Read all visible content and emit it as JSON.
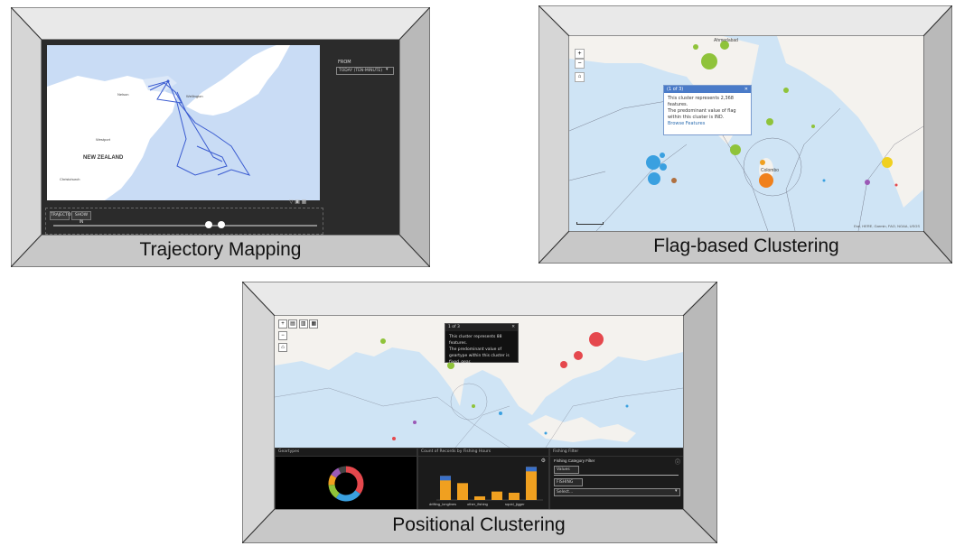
{
  "captions": {
    "trajectory": "Trajectory Mapping",
    "flag": "Flag-based Clustering",
    "positional": "Positional Clustering"
  },
  "trajectory_screen": {
    "panel_title": "FROM",
    "select_value": "TODAY (TEN-MINUTE)",
    "country_label": "NEW ZEALAND",
    "place_labels": [
      "Wellington",
      "Nelson",
      "Westport",
      "Christchurch"
    ],
    "buttons": [
      "TRAJECTORY",
      "SHOW IN"
    ],
    "slider_value": 0.6
  },
  "flag_screen": {
    "popup_header": "(1 of 3)",
    "popup_line1": "This cluster represents 2,368 features.",
    "popup_line2": "The predominant value of flag within this cluster is IND.",
    "popup_link": "Browse Features",
    "labels": [
      "Ahmedabad",
      "Colombo"
    ],
    "attribution": "Esri, HERE, Garmin, FAO, NOAA, USGS"
  },
  "positional_screen": {
    "popup_header": "1 of 3",
    "popup_line1": "This cluster represents 88 features.",
    "popup_line2": "The predominant value of geartype within this cluster is fixed_gear.",
    "panels": {
      "donut_title": "Geartypes",
      "bar_title": "Count of Records by Fishing Hours",
      "filter_title": "Fishing Filter",
      "filter_label": "Fishing Category Filter",
      "filter_select": "Values",
      "filter_field": "FISHING",
      "filter_placeholder": "Select...",
      "bar_categories": [
        "drifting_longlines",
        "other_fishing",
        "squid_jigger"
      ]
    },
    "bar_values": [
      40,
      28,
      6,
      14,
      12,
      55
    ],
    "donut_colors": [
      "#e5484d",
      "#3aa0e0",
      "#8fc33a",
      "#9b59b6",
      "#f0a020",
      "#444444"
    ]
  },
  "colors": {
    "frame_light": "#e9e9e9",
    "frame_mid": "#d0d0d0",
    "frame_dark": "#b5b5b5",
    "ocean": "#cfe4f5",
    "land": "#f4f2ee",
    "dark_ui": "#2b2b2b"
  }
}
